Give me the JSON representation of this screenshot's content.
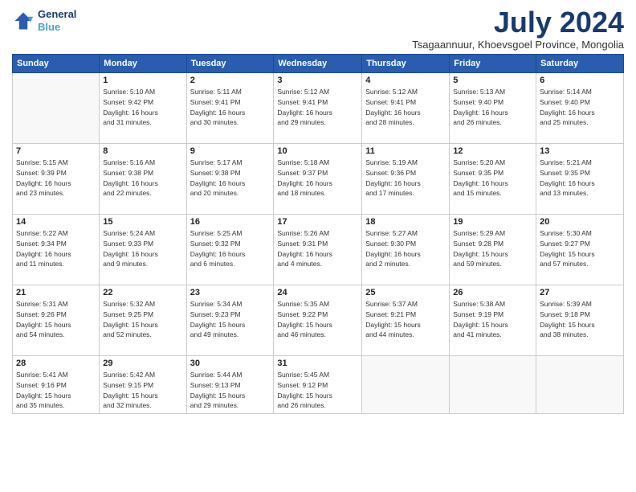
{
  "logo": {
    "line1": "General",
    "line2": "Blue"
  },
  "title": "July 2024",
  "subtitle": "Tsagaannuur, Khoevsgoel Province, Mongolia",
  "headers": [
    "Sunday",
    "Monday",
    "Tuesday",
    "Wednesday",
    "Thursday",
    "Friday",
    "Saturday"
  ],
  "weeks": [
    [
      {
        "day": "",
        "info": ""
      },
      {
        "day": "1",
        "info": "Sunrise: 5:10 AM\nSunset: 9:42 PM\nDaylight: 16 hours\nand 31 minutes."
      },
      {
        "day": "2",
        "info": "Sunrise: 5:11 AM\nSunset: 9:41 PM\nDaylight: 16 hours\nand 30 minutes."
      },
      {
        "day": "3",
        "info": "Sunrise: 5:12 AM\nSunset: 9:41 PM\nDaylight: 16 hours\nand 29 minutes."
      },
      {
        "day": "4",
        "info": "Sunrise: 5:12 AM\nSunset: 9:41 PM\nDaylight: 16 hours\nand 28 minutes."
      },
      {
        "day": "5",
        "info": "Sunrise: 5:13 AM\nSunset: 9:40 PM\nDaylight: 16 hours\nand 26 minutes."
      },
      {
        "day": "6",
        "info": "Sunrise: 5:14 AM\nSunset: 9:40 PM\nDaylight: 16 hours\nand 25 minutes."
      }
    ],
    [
      {
        "day": "7",
        "info": "Sunrise: 5:15 AM\nSunset: 9:39 PM\nDaylight: 16 hours\nand 23 minutes."
      },
      {
        "day": "8",
        "info": "Sunrise: 5:16 AM\nSunset: 9:38 PM\nDaylight: 16 hours\nand 22 minutes."
      },
      {
        "day": "9",
        "info": "Sunrise: 5:17 AM\nSunset: 9:38 PM\nDaylight: 16 hours\nand 20 minutes."
      },
      {
        "day": "10",
        "info": "Sunrise: 5:18 AM\nSunset: 9:37 PM\nDaylight: 16 hours\nand 18 minutes."
      },
      {
        "day": "11",
        "info": "Sunrise: 5:19 AM\nSunset: 9:36 PM\nDaylight: 16 hours\nand 17 minutes."
      },
      {
        "day": "12",
        "info": "Sunrise: 5:20 AM\nSunset: 9:35 PM\nDaylight: 16 hours\nand 15 minutes."
      },
      {
        "day": "13",
        "info": "Sunrise: 5:21 AM\nSunset: 9:35 PM\nDaylight: 16 hours\nand 13 minutes."
      }
    ],
    [
      {
        "day": "14",
        "info": "Sunrise: 5:22 AM\nSunset: 9:34 PM\nDaylight: 16 hours\nand 11 minutes."
      },
      {
        "day": "15",
        "info": "Sunrise: 5:24 AM\nSunset: 9:33 PM\nDaylight: 16 hours\nand 9 minutes."
      },
      {
        "day": "16",
        "info": "Sunrise: 5:25 AM\nSunset: 9:32 PM\nDaylight: 16 hours\nand 6 minutes."
      },
      {
        "day": "17",
        "info": "Sunrise: 5:26 AM\nSunset: 9:31 PM\nDaylight: 16 hours\nand 4 minutes."
      },
      {
        "day": "18",
        "info": "Sunrise: 5:27 AM\nSunset: 9:30 PM\nDaylight: 16 hours\nand 2 minutes."
      },
      {
        "day": "19",
        "info": "Sunrise: 5:29 AM\nSunset: 9:28 PM\nDaylight: 15 hours\nand 59 minutes."
      },
      {
        "day": "20",
        "info": "Sunrise: 5:30 AM\nSunset: 9:27 PM\nDaylight: 15 hours\nand 57 minutes."
      }
    ],
    [
      {
        "day": "21",
        "info": "Sunrise: 5:31 AM\nSunset: 9:26 PM\nDaylight: 15 hours\nand 54 minutes."
      },
      {
        "day": "22",
        "info": "Sunrise: 5:32 AM\nSunset: 9:25 PM\nDaylight: 15 hours\nand 52 minutes."
      },
      {
        "day": "23",
        "info": "Sunrise: 5:34 AM\nSunset: 9:23 PM\nDaylight: 15 hours\nand 49 minutes."
      },
      {
        "day": "24",
        "info": "Sunrise: 5:35 AM\nSunset: 9:22 PM\nDaylight: 15 hours\nand 46 minutes."
      },
      {
        "day": "25",
        "info": "Sunrise: 5:37 AM\nSunset: 9:21 PM\nDaylight: 15 hours\nand 44 minutes."
      },
      {
        "day": "26",
        "info": "Sunrise: 5:38 AM\nSunset: 9:19 PM\nDaylight: 15 hours\nand 41 minutes."
      },
      {
        "day": "27",
        "info": "Sunrise: 5:39 AM\nSunset: 9:18 PM\nDaylight: 15 hours\nand 38 minutes."
      }
    ],
    [
      {
        "day": "28",
        "info": "Sunrise: 5:41 AM\nSunset: 9:16 PM\nDaylight: 15 hours\nand 35 minutes."
      },
      {
        "day": "29",
        "info": "Sunrise: 5:42 AM\nSunset: 9:15 PM\nDaylight: 15 hours\nand 32 minutes."
      },
      {
        "day": "30",
        "info": "Sunrise: 5:44 AM\nSunset: 9:13 PM\nDaylight: 15 hours\nand 29 minutes."
      },
      {
        "day": "31",
        "info": "Sunrise: 5:45 AM\nSunset: 9:12 PM\nDaylight: 15 hours\nand 26 minutes."
      },
      {
        "day": "",
        "info": ""
      },
      {
        "day": "",
        "info": ""
      },
      {
        "day": "",
        "info": ""
      }
    ]
  ]
}
